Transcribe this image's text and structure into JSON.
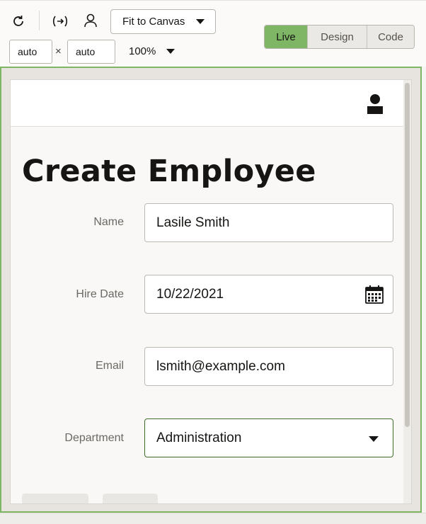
{
  "toolbar": {
    "icons": [
      "refresh-icon",
      "resize-horizontal-icon",
      "user-icon"
    ],
    "fit_label": "Fit to Canvas",
    "width_value": "auto",
    "height_value": "auto",
    "times_symbol": "×",
    "zoom_label": "100%",
    "modes": [
      {
        "label": "Live",
        "active": true
      },
      {
        "label": "Design",
        "active": false
      },
      {
        "label": "Code",
        "active": false
      }
    ],
    "accent_color": "#7eb665"
  },
  "app": {
    "header_icon": "user-avatar-icon",
    "title": "Create Employee",
    "form": {
      "name_label": "Name",
      "name_value": "Lasile Smith",
      "hire_label": "Hire Date",
      "hire_value": "10/22/2021",
      "email_label": "Email",
      "email_value": "lsmith@example.com",
      "dept_label": "Department",
      "dept_value": "Administration"
    }
  }
}
